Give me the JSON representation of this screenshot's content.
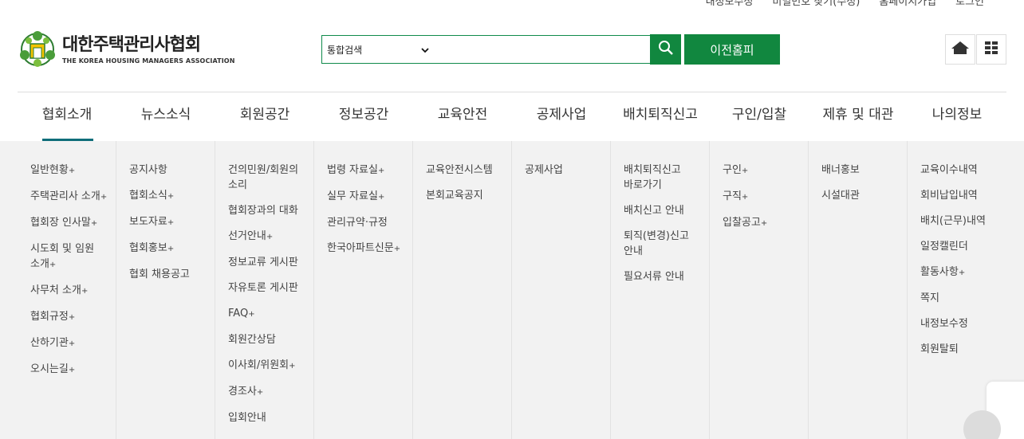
{
  "top_links": [
    "내정보수정",
    "비밀번호 찾기(수정)",
    "홈페이지가입",
    "로그인"
  ],
  "logo": {
    "title": "대한주택관리사협회",
    "subtitle": "THE KOREA HOUSING MANAGERS ASSOCIATION"
  },
  "search": {
    "select_value": "통합검색",
    "query": "",
    "button_icon": "search-icon",
    "prev_home_label": "이전홈피"
  },
  "quick_buttons": [
    {
      "icon": "home-icon"
    },
    {
      "icon": "grid-menu-icon"
    }
  ],
  "colors": {
    "accent_green": "#11873f",
    "active_underline": "#0f6e7a",
    "mega_bg": "#f2f2f2"
  },
  "gnb": [
    {
      "label": "협회소개",
      "active": true,
      "items": [
        {
          "label": "일반현황",
          "more": true
        },
        {
          "label": "주택관리사 소개",
          "more": true
        },
        {
          "label": "협회장 인사말",
          "more": true
        },
        {
          "label": "시도회 및 임원 소개",
          "more": true
        },
        {
          "label": "사무처 소개",
          "more": true
        },
        {
          "label": "협회규정",
          "more": true
        },
        {
          "label": "산하기관",
          "more": true
        },
        {
          "label": "오시는길",
          "more": true
        }
      ]
    },
    {
      "label": "뉴스소식",
      "active": false,
      "items": [
        {
          "label": "공지사항",
          "more": false
        },
        {
          "label": "협회소식",
          "more": true
        },
        {
          "label": "보도자료",
          "more": true
        },
        {
          "label": "협회홍보",
          "more": true
        },
        {
          "label": "협회 채용공고",
          "more": false
        }
      ]
    },
    {
      "label": "회원공간",
      "active": false,
      "items": [
        {
          "label": "건의민원/회원의 소리",
          "more": false
        },
        {
          "label": "협회장과의 대화",
          "more": false
        },
        {
          "label": "선거안내",
          "more": true
        },
        {
          "label": "정보교류 게시판",
          "more": false
        },
        {
          "label": "자유토론 게시판",
          "more": false
        },
        {
          "label": "FAQ",
          "more": true
        },
        {
          "label": "회원간상담",
          "more": false
        },
        {
          "label": "이사회/위원회",
          "more": true
        },
        {
          "label": "경조사",
          "more": true
        },
        {
          "label": "입회안내",
          "more": false
        }
      ]
    },
    {
      "label": "정보공간",
      "active": false,
      "items": [
        {
          "label": "법령 자료실",
          "more": true
        },
        {
          "label": "실무 자료실",
          "more": true
        },
        {
          "label": "관리규약·규정",
          "more": false
        },
        {
          "label": "한국아파트신문",
          "more": true
        }
      ]
    },
    {
      "label": "교육안전",
      "active": false,
      "items": [
        {
          "label": "교육안전시스템",
          "more": false
        },
        {
          "label": "본회교육공지",
          "more": false
        }
      ]
    },
    {
      "label": "공제사업",
      "active": false,
      "items": [
        {
          "label": "공제사업",
          "more": false
        }
      ]
    },
    {
      "label": "배치퇴직신고",
      "active": false,
      "items": [
        {
          "label": "배치퇴직신고 바로가기",
          "more": false
        },
        {
          "label": "배치신고 안내",
          "more": false
        },
        {
          "label": "퇴직(변경)신고 안내",
          "more": false
        },
        {
          "label": "필요서류 안내",
          "more": false
        }
      ]
    },
    {
      "label": "구인/입찰",
      "active": false,
      "items": [
        {
          "label": "구인",
          "more": true
        },
        {
          "label": "구직",
          "more": true
        },
        {
          "label": "입찰공고",
          "more": true
        }
      ]
    },
    {
      "label": "제휴 및 대관",
      "active": false,
      "items": [
        {
          "label": "배너홍보",
          "more": false
        },
        {
          "label": "시설대관",
          "more": false
        }
      ]
    },
    {
      "label": "나의정보",
      "active": false,
      "items": [
        {
          "label": "교육이수내역",
          "more": false
        },
        {
          "label": "회비납입내역",
          "more": false
        },
        {
          "label": "배치(근무)내역",
          "more": false
        },
        {
          "label": "일정캘린더",
          "more": false
        },
        {
          "label": "활동사항",
          "more": true
        },
        {
          "label": "쪽지",
          "more": false
        },
        {
          "label": "내정보수정",
          "more": false
        },
        {
          "label": "회원탈퇴",
          "more": false
        }
      ]
    }
  ]
}
